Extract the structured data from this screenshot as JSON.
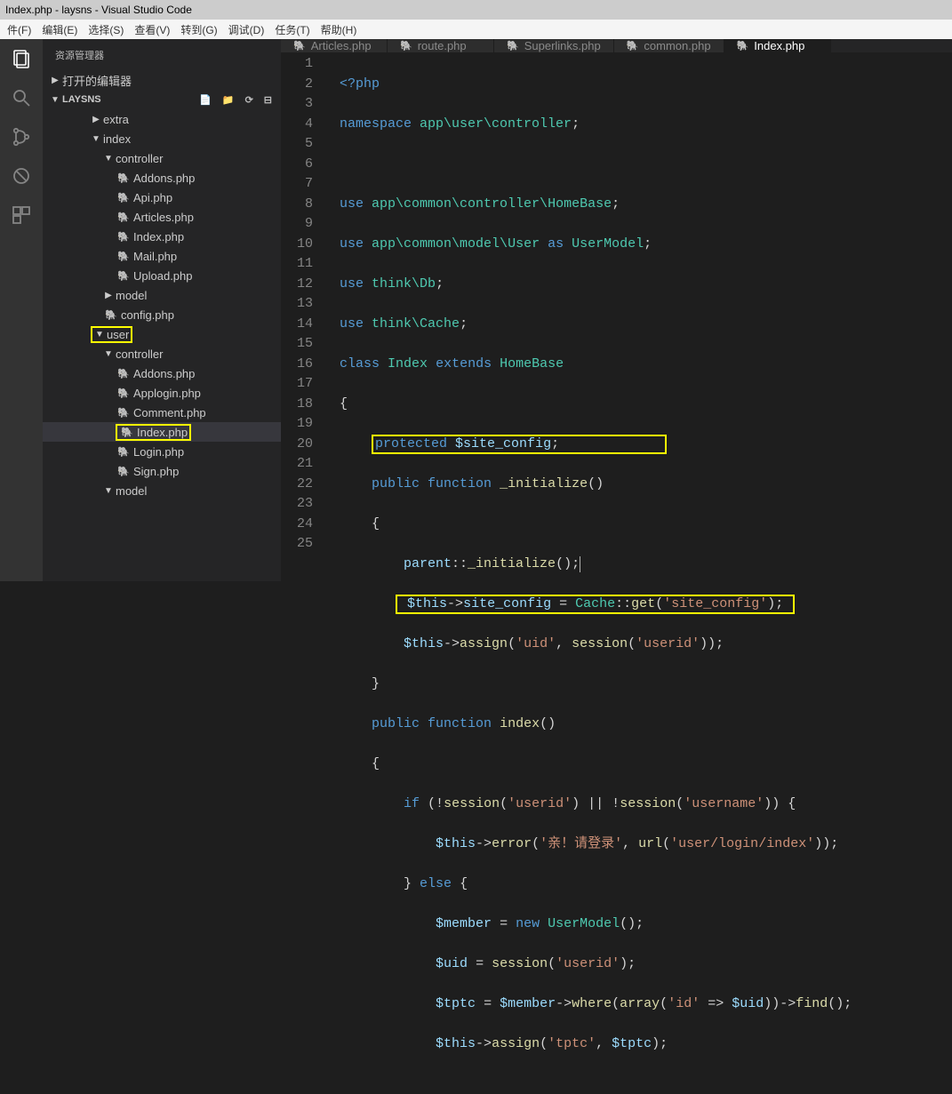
{
  "title": "Index.php - laysns - Visual Studio Code",
  "menu": [
    "件(F)",
    "编辑(E)",
    "选择(S)",
    "查看(V)",
    "转到(G)",
    "调试(D)",
    "任务(T)",
    "帮助(H)"
  ],
  "explorer": {
    "header": "资源管理器",
    "section1": "打开的编辑器",
    "section2": "LAYSNS",
    "tree": [
      {
        "depth": 3,
        "type": "folder",
        "open": false,
        "label": "extra"
      },
      {
        "depth": 3,
        "type": "folder",
        "open": true,
        "label": "index"
      },
      {
        "depth": 4,
        "type": "folder",
        "open": true,
        "label": "controller"
      },
      {
        "depth": 5,
        "type": "file",
        "label": "Addons.php"
      },
      {
        "depth": 5,
        "type": "file",
        "label": "Api.php"
      },
      {
        "depth": 5,
        "type": "file",
        "label": "Articles.php"
      },
      {
        "depth": 5,
        "type": "file",
        "label": "Index.php"
      },
      {
        "depth": 5,
        "type": "file",
        "label": "Mail.php"
      },
      {
        "depth": 5,
        "type": "file",
        "label": "Upload.php"
      },
      {
        "depth": 4,
        "type": "folder",
        "open": false,
        "label": "model"
      },
      {
        "depth": 4,
        "type": "file",
        "label": "config.php"
      },
      {
        "depth": 3,
        "type": "folder",
        "open": true,
        "label": "user",
        "highlight": true
      },
      {
        "depth": 4,
        "type": "folder",
        "open": true,
        "label": "controller"
      },
      {
        "depth": 5,
        "type": "file",
        "label": "Addons.php"
      },
      {
        "depth": 5,
        "type": "file",
        "label": "Applogin.php"
      },
      {
        "depth": 5,
        "type": "file",
        "label": "Comment.php"
      },
      {
        "depth": 5,
        "type": "file",
        "label": "Index.php",
        "highlight": true,
        "selected": true
      },
      {
        "depth": 5,
        "type": "file",
        "label": "Login.php"
      },
      {
        "depth": 5,
        "type": "file",
        "label": "Sign.php"
      },
      {
        "depth": 4,
        "type": "folder",
        "open": true,
        "label": "model"
      }
    ]
  },
  "tabs": [
    {
      "label": "Articles.php",
      "active": false
    },
    {
      "label": "route.php",
      "active": false
    },
    {
      "label": "Superlinks.php",
      "active": false
    },
    {
      "label": "common.php",
      "active": false
    },
    {
      "label": "Index.php",
      "active": true
    }
  ],
  "code": {
    "line01": "<?php",
    "line02_ns": "namespace",
    "line02_path": "app\\user\\controller",
    "line04_use": "use",
    "line04_p": "app\\common\\controller\\",
    "line04_c": "HomeBase",
    "line05_p": "app\\common\\model\\",
    "line05_c": "User",
    "line05_as": "as",
    "line05_a": "UserModel",
    "line06_p": "think\\",
    "line06_c": "Db",
    "line07_p": "think\\",
    "line07_c": "Cache",
    "line08_class": "class",
    "line08_name": "Index",
    "line08_ext": "extends",
    "line08_base": "HomeBase",
    "line10_mod": "protected",
    "line10_var": "$site_config",
    "line11_mod": "public",
    "line11_fn": "function",
    "line11_name": "_initialize",
    "line13_p": "parent",
    "line13_m": "_initialize",
    "line14_this": "$this",
    "line14_prop": "site_config",
    "line14_cls": "Cache",
    "line14_get": "get",
    "line14_arg": "'site_config'",
    "line15_assign": "assign",
    "line15_uid": "'uid'",
    "line15_sess": "session",
    "line15_userid": "'userid'",
    "line17_name": "index",
    "line19_if": "if",
    "line19_s1": "'userid'",
    "line19_s2": "'username'",
    "line20_err": "error",
    "line20_msg": "'亲！请登录'",
    "line20_url": "url",
    "line20_path": "'user/login/index'",
    "line21_else": "else",
    "line22_var": "$member",
    "line22_new": "new",
    "line22_cls": "UserModel",
    "line23_var": "$uid",
    "line24_var": "$tptc",
    "line24_where": "where",
    "line24_arr": "array",
    "line24_id": "'id'",
    "line24_find": "find",
    "line25_k": "'tptc'"
  }
}
